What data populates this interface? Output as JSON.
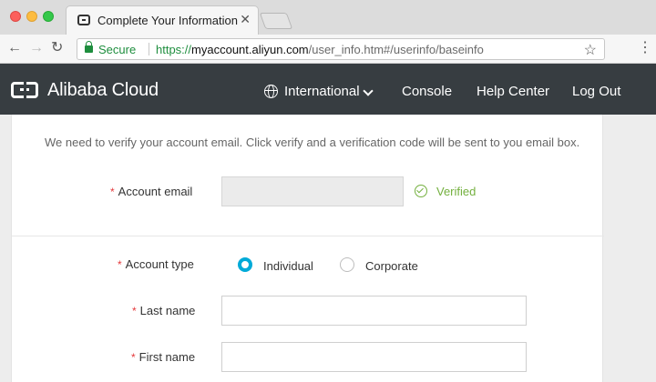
{
  "browser": {
    "tab_title": "Complete Your Information",
    "tab_close": "✕",
    "secure_label": "Secure",
    "url_scheme": "https://",
    "url_host": "myaccount.aliyun.com",
    "url_path": "/user_info.htm#/userinfo/baseinfo",
    "nav_back": "←",
    "nav_forward": "→",
    "nav_reload": "↻",
    "bookmark": "☆",
    "menu": "⋮"
  },
  "header": {
    "logo_text": "Alibaba Cloud",
    "nav": [
      "International",
      "Console",
      "Help Center",
      "Log Out"
    ]
  },
  "form": {
    "intro": "We need to verify your account email. Click verify and a verification code will be sent to you email box.",
    "required_mark": "*",
    "email_label": "Account email",
    "email_value": "",
    "email_status": "Verified",
    "type_label": "Account type",
    "type_options": [
      "Individual",
      "Corporate"
    ],
    "type_selected": "Individual",
    "last_name_label": "Last name",
    "last_name_value": "",
    "first_name_label": "First name",
    "first_name_value": ""
  },
  "colors": {
    "header_bg": "#373d41",
    "verified": "#74b03f",
    "radio_selected": "#00aad8",
    "required": "#e4393c"
  }
}
